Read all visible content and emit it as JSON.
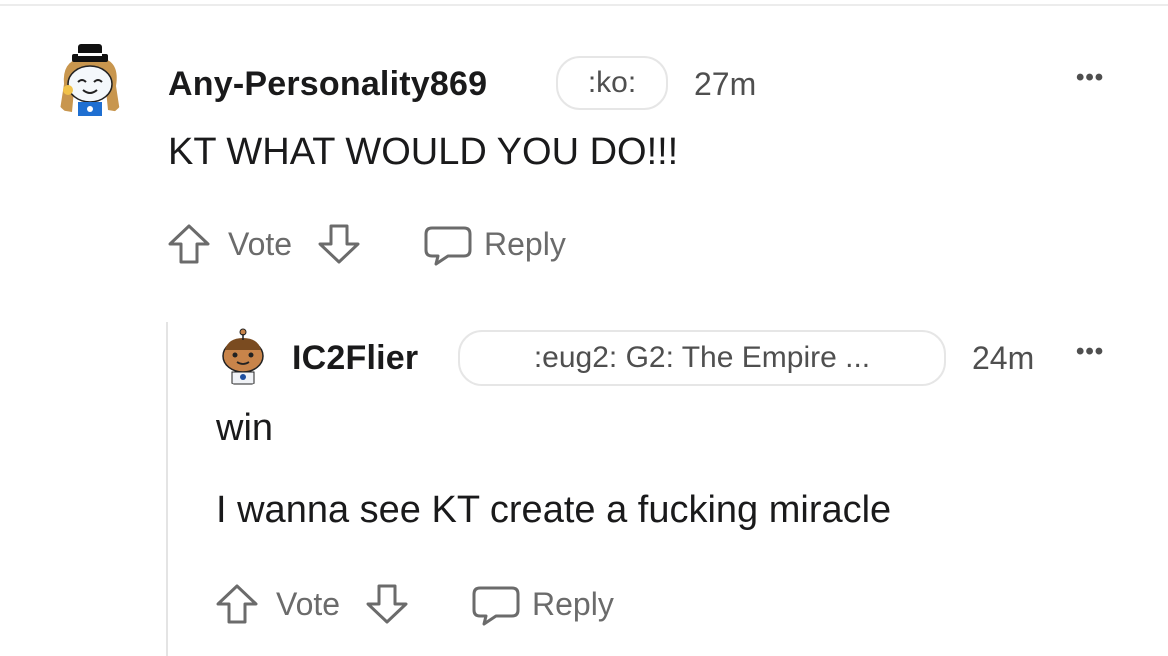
{
  "comments": [
    {
      "username": "Any-Personality869",
      "flair": ":ko:",
      "time": "27m",
      "more_label": "•••",
      "lines": [
        "KT WHAT WOULD YOU DO!!!"
      ],
      "actions": {
        "vote_label": "Vote",
        "reply_label": "Reply"
      }
    },
    {
      "username": "IC2Flier",
      "flair": ":eug2: G2: The Empire ...",
      "time": "24m",
      "more_label": "•••",
      "lines": [
        "win",
        "I wanna see KT create a fucking miracle"
      ],
      "actions": {
        "vote_label": "Vote",
        "reply_label": "Reply"
      }
    }
  ],
  "icons": [
    "upvote-arrow-icon",
    "downvote-arrow-icon",
    "reply-bubble-icon",
    "more-options-icon"
  ],
  "colors": {
    "text": "#1a1a1b",
    "meta": "#4f4f4f",
    "action": "#6b6b6b",
    "border": "#e6e6e6",
    "thread_line": "#e4e4e4"
  }
}
